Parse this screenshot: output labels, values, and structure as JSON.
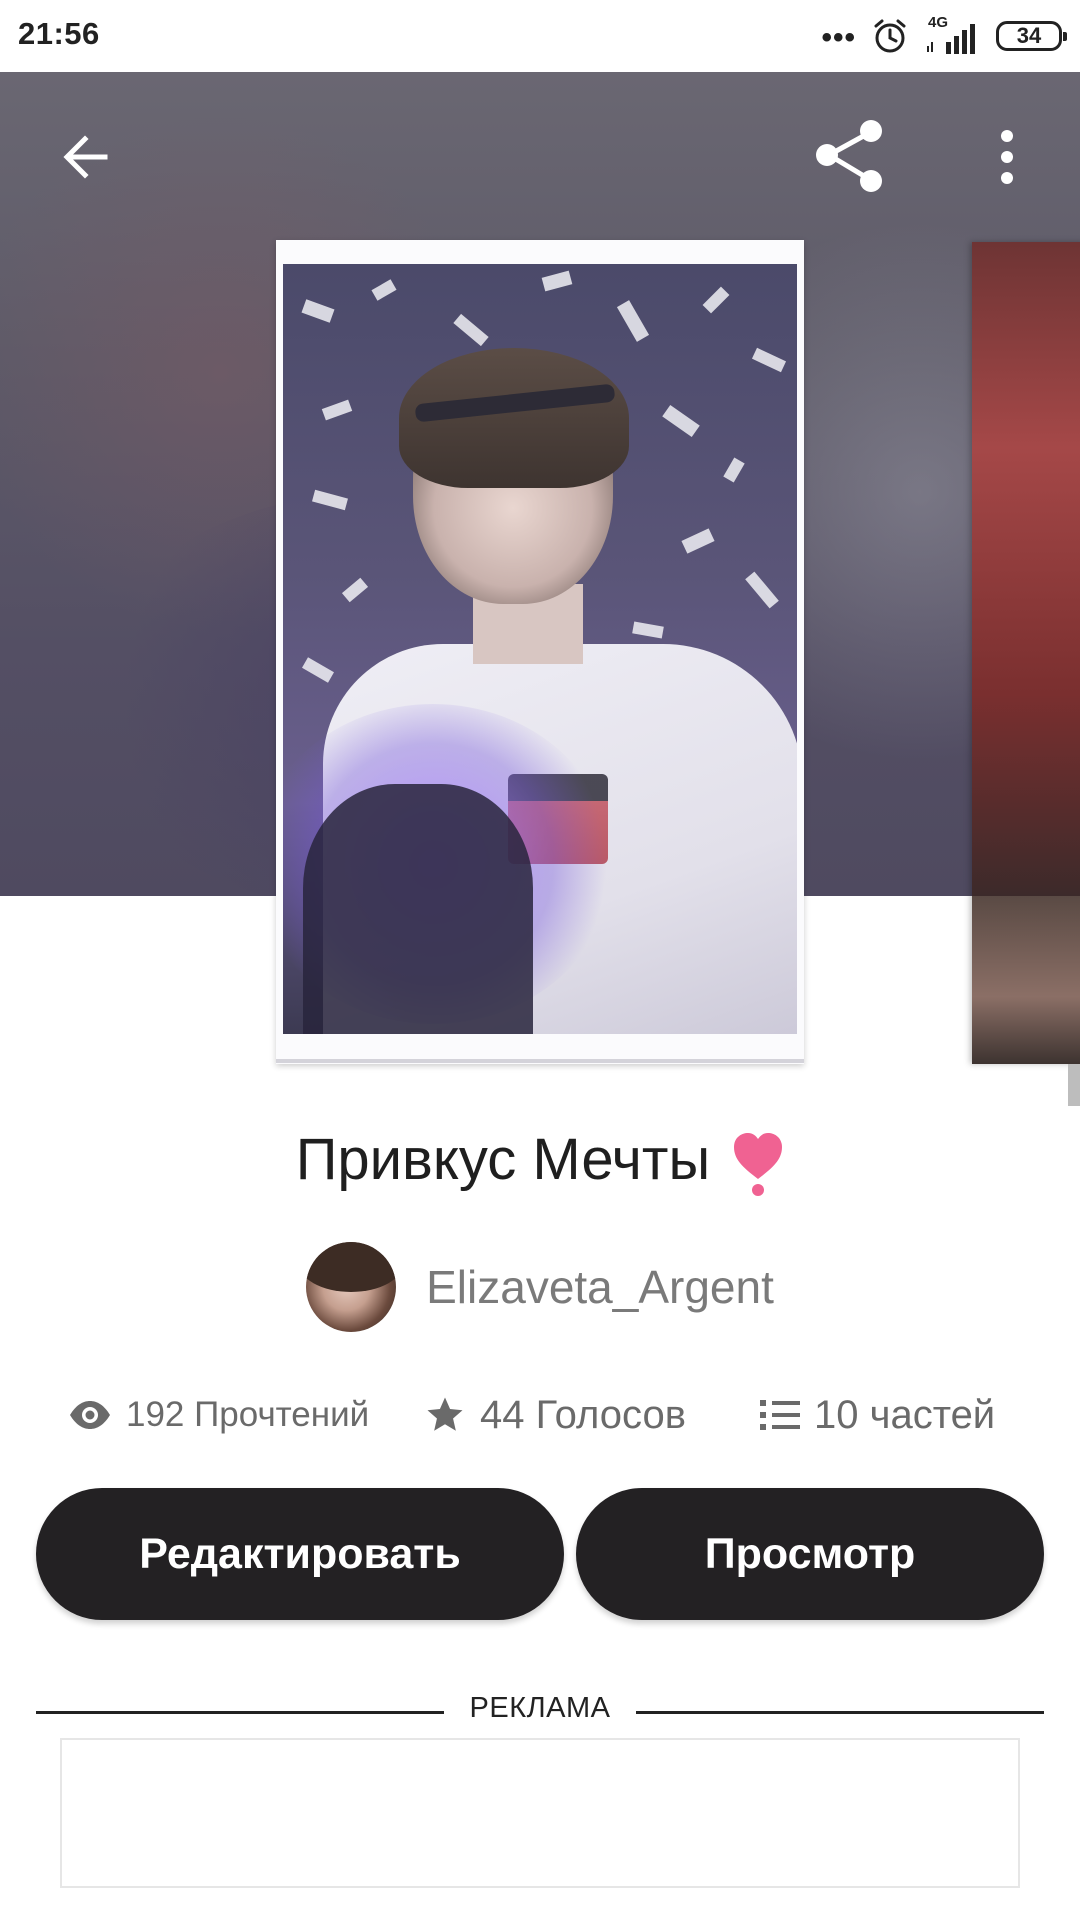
{
  "status_bar": {
    "time": "21:56",
    "dots": "•••",
    "network": "4G",
    "battery": "34"
  },
  "header": {
    "back_icon": "arrow-left-icon",
    "share_icon": "share-icon",
    "more_icon": "more-vertical-icon"
  },
  "story": {
    "title": "Привкус Мечты",
    "title_emoji": "heart-exclamation-icon",
    "author": "Elizaveta_Argent",
    "stats": {
      "reads": "192 Прочтений",
      "votes": "44 Голосов",
      "parts": "10 частей"
    }
  },
  "actions": {
    "edit_label": "Редактировать",
    "view_label": "Просмотр"
  },
  "ad": {
    "label": "РЕКЛАМА"
  },
  "colors": {
    "button_bg": "#232123",
    "heart": "#f06292",
    "text_muted": "#6a6a6a"
  }
}
